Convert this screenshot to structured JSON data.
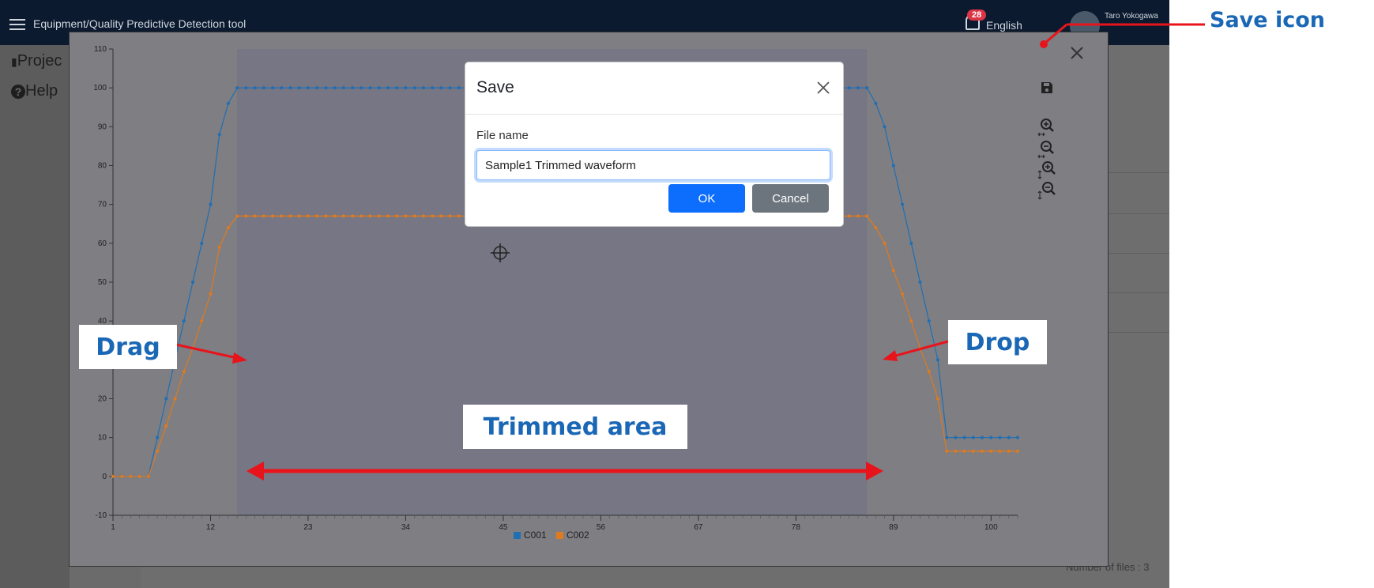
{
  "app": {
    "title": "Equipment/Quality Predictive Detection tool",
    "notification_count": "28",
    "language": "English",
    "user": "Taro Yokogawa",
    "sidebar": [
      "Projec",
      "Help"
    ],
    "files_count": "Number of files : 3"
  },
  "colors": {
    "series_c001": "#1f6fb4",
    "series_c002": "#e07a1f",
    "annotation": "#e8141b",
    "callout_text": "#1a67b5"
  },
  "chart_data": {
    "type": "line",
    "x_ticks": [
      1,
      12,
      23,
      34,
      45,
      56,
      67,
      78,
      89,
      100
    ],
    "y_ticks": [
      -10,
      0,
      10,
      20,
      30,
      40,
      50,
      60,
      70,
      80,
      90,
      100,
      110
    ],
    "xlim": [
      1,
      103
    ],
    "ylim": [
      -10,
      110
    ],
    "legend": [
      "C001",
      "C002"
    ],
    "legend_position": "bottom-center",
    "series": [
      {
        "name": "C001",
        "points": [
          [
            1,
            0
          ],
          [
            5,
            0
          ],
          [
            6,
            10
          ],
          [
            7,
            20
          ],
          [
            8,
            30
          ],
          [
            9,
            40
          ],
          [
            10,
            50
          ],
          [
            11,
            60
          ],
          [
            12,
            70
          ],
          [
            13,
            88
          ],
          [
            14,
            96
          ],
          [
            15,
            100
          ],
          [
            86,
            100
          ],
          [
            87,
            96
          ],
          [
            88,
            90
          ],
          [
            89,
            80
          ],
          [
            90,
            70
          ],
          [
            91,
            60
          ],
          [
            92,
            50
          ],
          [
            93,
            40
          ],
          [
            94,
            30
          ],
          [
            95,
            10
          ],
          [
            103,
            10
          ]
        ]
      },
      {
        "name": "C002",
        "points": [
          [
            1,
            0
          ],
          [
            5,
            0
          ],
          [
            6,
            6.5
          ],
          [
            7,
            13
          ],
          [
            8,
            20
          ],
          [
            9,
            27
          ],
          [
            10,
            33
          ],
          [
            11,
            40
          ],
          [
            12,
            47
          ],
          [
            13,
            59
          ],
          [
            14,
            64
          ],
          [
            15,
            67
          ],
          [
            86,
            67
          ],
          [
            87,
            64
          ],
          [
            88,
            60
          ],
          [
            89,
            53
          ],
          [
            90,
            47
          ],
          [
            91,
            40
          ],
          [
            92,
            33
          ],
          [
            93,
            27
          ],
          [
            94,
            20
          ],
          [
            95,
            6.5
          ],
          [
            103,
            6.5
          ]
        ]
      }
    ],
    "trimmed_range": [
      15,
      86
    ]
  },
  "tools": [
    "save-icon",
    "zoom-in-x-icon",
    "zoom-out-x-icon",
    "zoom-in-y-icon",
    "zoom-out-y-icon"
  ],
  "save_dialog": {
    "title": "Save",
    "file_label": "File name",
    "file_value": "Sample1 Trimmed waveform",
    "ok": "OK",
    "cancel": "Cancel"
  },
  "annotations": {
    "save_icon": "Save icon",
    "drag": "Drag",
    "drop": "Drop",
    "trimmed_area": "Trimmed area"
  }
}
